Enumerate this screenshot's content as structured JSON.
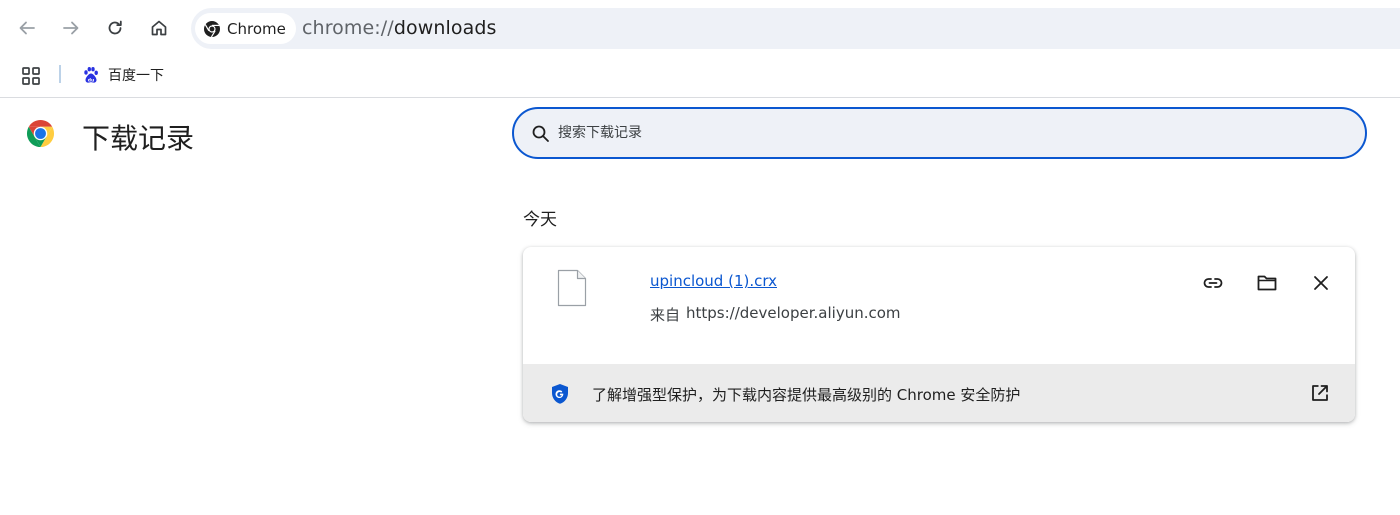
{
  "toolbar": {
    "back_icon": "arrow-left-icon",
    "forward_icon": "arrow-right-icon",
    "reload_icon": "reload-icon",
    "home_icon": "home-icon",
    "chip_label": "Chrome",
    "url_scheme": "chrome://",
    "url_path": "downloads"
  },
  "bookmarks": {
    "apps_icon": "apps-grid-icon",
    "items": [
      {
        "label": "百度一下",
        "icon": "baidu-paw-icon"
      }
    ]
  },
  "header": {
    "title": "下载记录",
    "logo": "chrome-logo"
  },
  "search": {
    "placeholder": "搜索下载记录"
  },
  "sections": [
    {
      "label": "今天",
      "downloads": [
        {
          "file_name": "upincloud (1).crx",
          "source_prefix": "来自",
          "source_url": "https://developer.aliyun.com",
          "actions": [
            "copy-link-icon",
            "show-in-folder-icon",
            "remove-icon"
          ]
        }
      ]
    }
  ],
  "promo": {
    "text": "了解增强型保护，为下载内容提供最高级别的 Chrome 安全防护",
    "icon": "shield-g-icon",
    "open_icon": "open-in-new-icon"
  },
  "colors": {
    "accent": "#0b57d0",
    "omnibox_bg": "#eef1f7",
    "footer_bg": "#ebebeb"
  }
}
